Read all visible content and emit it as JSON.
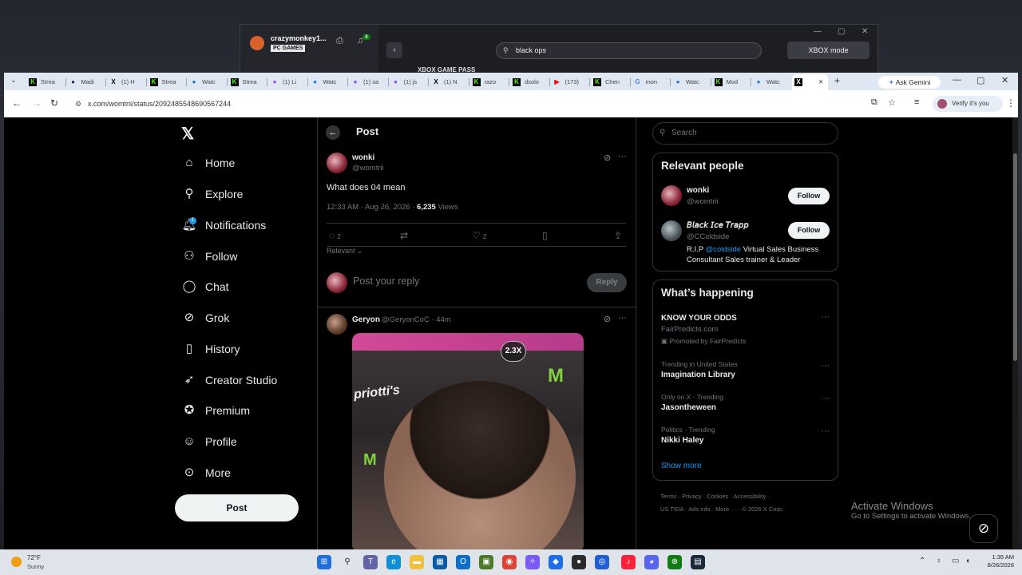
{
  "xbox": {
    "username": "crazymonkey1...",
    "platform": "PC GAMES",
    "notif_count": "4",
    "search_value": "black ops",
    "mode_button": "XBOX mode",
    "game_pass": "XBOX GAME PASS"
  },
  "browser": {
    "tabs": [
      {
        "label": "Strea",
        "icon": "kick-icon",
        "color": "#53fc18"
      },
      {
        "label": "Madi",
        "icon": "site-icon",
        "color": "#2b2b5a"
      },
      {
        "label": "(1) H",
        "icon": "x-icon",
        "color": "#000000"
      },
      {
        "label": "Strea",
        "icon": "kick-icon",
        "color": "#53fc18"
      },
      {
        "label": "Watc",
        "icon": "stream-icon",
        "color": "#1a73e8"
      },
      {
        "label": "Strea",
        "icon": "kick-icon",
        "color": "#53fc18"
      },
      {
        "label": "(1) Li",
        "icon": "twitch-icon",
        "color": "#9146ff"
      },
      {
        "label": "Watc",
        "icon": "stream-icon",
        "color": "#1a73e8"
      },
      {
        "label": "(1) sa",
        "icon": "twitch-icon",
        "color": "#9146ff"
      },
      {
        "label": "(1) js",
        "icon": "twitch-icon",
        "color": "#9146ff"
      },
      {
        "label": "(1) N",
        "icon": "x-icon",
        "color": "#000000"
      },
      {
        "label": "razo",
        "icon": "kick-icon",
        "color": "#53fc18"
      },
      {
        "label": "dsolo",
        "icon": "kick-icon",
        "color": "#53fc18"
      },
      {
        "label": "(173)",
        "icon": "youtube-icon",
        "color": "#ff0000"
      },
      {
        "label": "Chen",
        "icon": "kick-icon",
        "color": "#53fc18"
      },
      {
        "label": "mon",
        "icon": "google-icon",
        "color": "#4285f4"
      },
      {
        "label": "Watc",
        "icon": "stream-icon",
        "color": "#1a73e8"
      },
      {
        "label": "Mod",
        "icon": "kick-icon",
        "color": "#53fc18"
      },
      {
        "label": "Watc",
        "icon": "stream-icon",
        "color": "#1a73e8"
      }
    ],
    "active_tab_icon": "x-icon",
    "ask_gemini": "Ask Gemini",
    "url": "x.com/womtrii/status/2092485548690567244",
    "verify": "Verify it's you"
  },
  "nav": {
    "items": [
      {
        "label": "Home",
        "icon": "home-icon",
        "glyph": "⌂"
      },
      {
        "label": "Explore",
        "icon": "search-icon",
        "glyph": "⚲"
      },
      {
        "label": "Notifications",
        "icon": "bell-icon",
        "glyph": "🔔︎"
      },
      {
        "label": "Follow",
        "icon": "person-add-icon",
        "glyph": "⚇"
      },
      {
        "label": "Chat",
        "icon": "chat-icon",
        "glyph": "◯"
      },
      {
        "label": "Grok",
        "icon": "grok-icon",
        "glyph": "⊘"
      },
      {
        "label": "History",
        "icon": "bookmark-icon",
        "glyph": "▯"
      },
      {
        "label": "Creator Studio",
        "icon": "rocket-icon",
        "glyph": "➶"
      },
      {
        "label": "Premium",
        "icon": "verified-icon",
        "glyph": "✪"
      },
      {
        "label": "Profile",
        "icon": "profile-icon",
        "glyph": "☺"
      },
      {
        "label": "More",
        "icon": "more-icon",
        "glyph": "⊙"
      }
    ],
    "notif_badge": "1",
    "post_button": "Post"
  },
  "post": {
    "header": "Post",
    "author_name": "wonki",
    "author_handle": "@womtrii",
    "text": "What does 04 mean",
    "time": "12:33 AM · Aug 26, 2026 · ",
    "views_count": "6,235",
    "views_label": " Views",
    "replies": "2",
    "likes": "2",
    "sort_label": "Relevant",
    "reply_placeholder": "Post your reply",
    "reply_button": "Reply"
  },
  "reply": {
    "author_name": "Geryon",
    "author_handle": "@GeryonCoC · 44m",
    "zoom": "2.3X",
    "media_text_1": "priotti's",
    "media_text_2": "M"
  },
  "sidebar": {
    "search_placeholder": "Search",
    "relevant_title": "Relevant people",
    "people": [
      {
        "name": "wonki",
        "handle": "@womtrii",
        "button": "Follow"
      },
      {
        "name": "𝘉𝘭𝘢𝘤𝘬 𝘐𝘤𝘦 𝘛𝘳𝘢𝘱𝘱",
        "handle": "@CColdside",
        "button": "Follow"
      }
    ],
    "bio_prefix": "R.I.P ",
    "bio_link": "@coldside",
    "bio_rest": " Virtual Sales Business Consultant Sales trainer & Leader",
    "happening_title": "What’s happening",
    "ad_title": "KNOW YOUR ODDS",
    "ad_domain": "FairPredicts.com",
    "ad_promo": "Promoted by FairPredicts",
    "trends": [
      {
        "context": "Trending in United States",
        "topic": "Imagination Library"
      },
      {
        "context": "Only on X · Trending",
        "topic": "Jasontheween"
      },
      {
        "context": "Politics · Trending",
        "topic": "Nikki Haley"
      }
    ],
    "show_more": "Show more",
    "footer_1": "Terms  ·  Privacy  ·  Cookies  ·  Accessibility  ·",
    "footer_2": "US TIDA  ·  Ads info  ·  More ···  ·  © 2026 X Corp."
  },
  "windows": {
    "activate_title": "Activate Windows",
    "activate_sub": "Go to Settings to activate Windows.",
    "temp": "72°F",
    "condition": "Sunny",
    "time": "1:35 AM",
    "date": "8/26/2026"
  }
}
